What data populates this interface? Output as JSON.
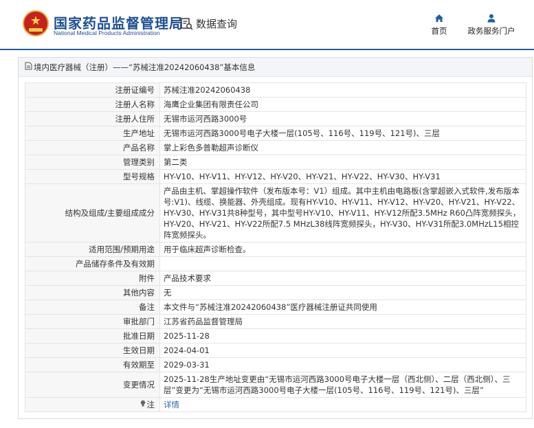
{
  "header": {
    "logo_cn": "国家药品监督管理局",
    "logo_en": "National Medical Products Administration",
    "query_label": "数据查询",
    "nav": [
      {
        "label": "首页",
        "icon": "home-icon"
      },
      {
        "label": "政务服务门户",
        "icon": "user-icon"
      }
    ],
    "accent_color": "#1f5ea8"
  },
  "panel": {
    "title": "境内医疗器械（注册）——“苏械注准20242060438”基本信息",
    "rows": [
      {
        "key": "注册证编号",
        "value": "苏械注准20242060438"
      },
      {
        "key": "注册人名称",
        "value": "海鹰企业集团有限责任公司"
      },
      {
        "key": "注册人住所",
        "value": "无锡市运河西路3000号"
      },
      {
        "key": "生产地址",
        "value": "无锡市运河西路3000号电子大楼一层(105号、116号、119号、121号)、三层"
      },
      {
        "key": "产品名称",
        "value": "掌上彩色多普勒超声诊断仪"
      },
      {
        "key": "管理类别",
        "value": "第二类"
      },
      {
        "key": "型号规格",
        "value": "HY-V10、HY-V11、HY-V12、HY-V20、HY-V21、HY-V22、HY-V30、HY-V31"
      },
      {
        "key": "结构及组成/主要组成成分",
        "value": "产品由主机、掌超操作软件（发布版本号：V1）组成。其中主机由电路板(含掌超嵌入式软件,发布版本号:V1)、线缆、换能器、外壳组成。现有HY-V10、HY-V11、HY-V12、HY-V20、HY-V21、HY-V22、HY-V30、HY-V31共8种型号，其中型号HY-V10、HY-V11、HY-V12所配3.5MHz R60凸阵宽频探头，HY-V20、HY-V21、HY-V22所配7.5 MHzL38线阵宽频探头，HY-V30、HY-V31所配3.0MHzL15相控阵宽频探头。"
      },
      {
        "key": "适用范围/预期用途",
        "value": "用于临床超声诊断检查。"
      },
      {
        "key": "产品储存条件及有效期",
        "value": ""
      },
      {
        "key": "附件",
        "value": "产品技术要求"
      },
      {
        "key": "其他内容",
        "value": "无"
      },
      {
        "key": "备注",
        "value": "本文件与“苏械注准20242060438”医疗器械注册证共同使用"
      },
      {
        "key": "审批部门",
        "value": "江苏省药品监督管理局"
      },
      {
        "key": "批准日期",
        "value": "2025-11-28"
      },
      {
        "key": "生效日期",
        "value": "2024-04-01"
      },
      {
        "key": "有效期至",
        "value": "2029-03-31"
      },
      {
        "key": "变更情况",
        "value": "2025-11-28生产地址变更由“无锡市运河西路3000号电子大楼一层（西北侧）、二层（西北侧）、三层”变更为“无锡市运河西路3000号电子大楼一层(105号、116号、119号、121号)、三层”"
      }
    ],
    "note": {
      "key": "注",
      "value": "详情",
      "icon": "lightbulb-icon"
    }
  }
}
